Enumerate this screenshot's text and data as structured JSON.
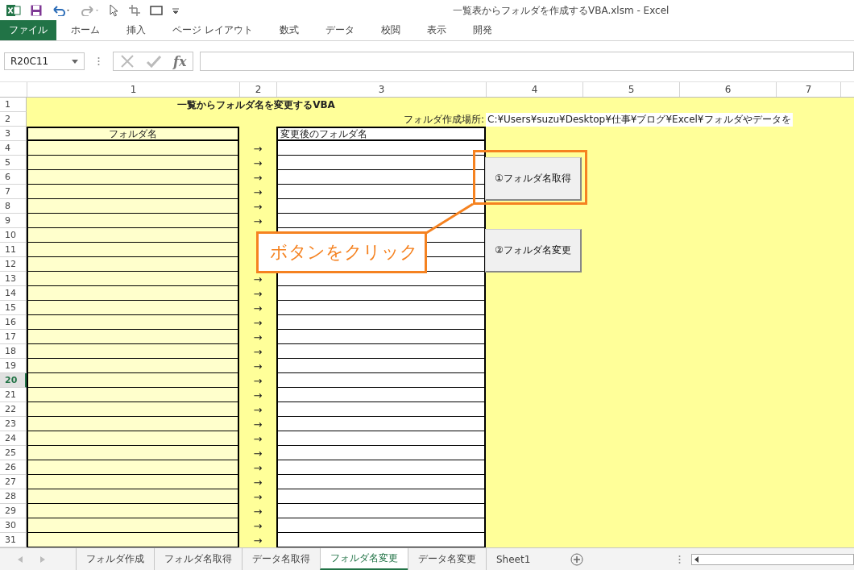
{
  "window": {
    "title": "一覧表からフォルダを作成するVBA.xlsm - Excel"
  },
  "ribbon_tabs": [
    {
      "label": "ファイル",
      "kind": "file"
    },
    {
      "label": "ホーム",
      "kind": "tab"
    },
    {
      "label": "挿入",
      "kind": "tab"
    },
    {
      "label": "ページ レイアウト",
      "kind": "tab"
    },
    {
      "label": "数式",
      "kind": "tab"
    },
    {
      "label": "データ",
      "kind": "tab"
    },
    {
      "label": "校閲",
      "kind": "tab"
    },
    {
      "label": "表示",
      "kind": "tab"
    },
    {
      "label": "開発",
      "kind": "tab"
    }
  ],
  "name_box": {
    "value": "R20C11"
  },
  "formula_button": "fx",
  "columns": [
    "1",
    "2",
    "3",
    "4",
    "5",
    "6",
    "7"
  ],
  "rows": [
    {
      "number": "1",
      "selected": false,
      "kind": "title",
      "text": "一覧からフォルダ名を変更するVBA"
    },
    {
      "number": "2",
      "selected": false,
      "kind": "location",
      "label": "フォルダ作成場所:",
      "value": "C:¥Users¥suzu¥Desktop¥仕事¥ブログ¥Excel¥フォルダやデータを"
    },
    {
      "number": "3",
      "selected": false,
      "kind": "header",
      "left": "フォルダ名",
      "right": "変更後のフォルダ名"
    },
    {
      "number": "4",
      "selected": false,
      "kind": "entry",
      "arrow": "→"
    },
    {
      "number": "5",
      "selected": false,
      "kind": "entry",
      "arrow": "→"
    },
    {
      "number": "6",
      "selected": false,
      "kind": "entry",
      "arrow": "→"
    },
    {
      "number": "7",
      "selected": false,
      "kind": "entry",
      "arrow": "→"
    },
    {
      "number": "8",
      "selected": false,
      "kind": "entry",
      "arrow": "→"
    },
    {
      "number": "9",
      "selected": false,
      "kind": "entry",
      "arrow": "→"
    },
    {
      "number": "10",
      "selected": false,
      "kind": "entry"
    },
    {
      "number": "11",
      "selected": false,
      "kind": "entry"
    },
    {
      "number": "12",
      "selected": false,
      "kind": "entry"
    },
    {
      "number": "13",
      "selected": false,
      "kind": "entry",
      "arrow": "→"
    },
    {
      "number": "14",
      "selected": false,
      "kind": "entry",
      "arrow": "→"
    },
    {
      "number": "15",
      "selected": false,
      "kind": "entry",
      "arrow": "→"
    },
    {
      "number": "16",
      "selected": false,
      "kind": "entry",
      "arrow": "→"
    },
    {
      "number": "17",
      "selected": false,
      "kind": "entry",
      "arrow": "→"
    },
    {
      "number": "18",
      "selected": false,
      "kind": "entry",
      "arrow": "→"
    },
    {
      "number": "19",
      "selected": false,
      "kind": "entry",
      "arrow": "→"
    },
    {
      "number": "20",
      "selected": true,
      "kind": "entry",
      "arrow": "→"
    },
    {
      "number": "21",
      "selected": false,
      "kind": "entry",
      "arrow": "→"
    },
    {
      "number": "22",
      "selected": false,
      "kind": "entry",
      "arrow": "→"
    },
    {
      "number": "23",
      "selected": false,
      "kind": "entry",
      "arrow": "→"
    },
    {
      "number": "24",
      "selected": false,
      "kind": "entry",
      "arrow": "→"
    },
    {
      "number": "25",
      "selected": false,
      "kind": "entry",
      "arrow": "→"
    },
    {
      "number": "26",
      "selected": false,
      "kind": "entry",
      "arrow": "→"
    },
    {
      "number": "27",
      "selected": false,
      "kind": "entry",
      "arrow": "→"
    },
    {
      "number": "28",
      "selected": false,
      "kind": "entry",
      "arrow": "→"
    },
    {
      "number": "29",
      "selected": false,
      "kind": "entry",
      "arrow": "→"
    },
    {
      "number": "30",
      "selected": false,
      "kind": "entry",
      "arrow": "→"
    },
    {
      "number": "31",
      "selected": false,
      "kind": "entry",
      "arrow": "→"
    }
  ],
  "buttons": [
    {
      "label": "①フォルダ名取得"
    },
    {
      "label": "②フォルダ名変更"
    }
  ],
  "callout": {
    "text": "ボタンをクリック"
  },
  "sheet_tabs": [
    {
      "label": "フォルダ作成",
      "selected": false
    },
    {
      "label": "フォルダ名取得",
      "selected": false
    },
    {
      "label": "データ名取得",
      "selected": false
    },
    {
      "label": "フォルダ名変更",
      "selected": true
    },
    {
      "label": "データ名変更",
      "selected": false
    },
    {
      "label": "Sheet1",
      "selected": false
    }
  ]
}
